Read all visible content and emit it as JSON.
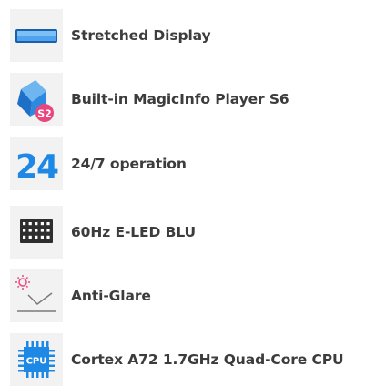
{
  "features": [
    {
      "icon": "stretched-display-icon",
      "label": "Stretched Display"
    },
    {
      "icon": "magicinfo-player-icon",
      "badge": "S2",
      "label": "Built-in MagicInfo Player S6"
    },
    {
      "icon": "operation-24-icon",
      "number": "24",
      "label": "24/7 operation"
    },
    {
      "icon": "eled-blu-icon",
      "label": "60Hz E-LED BLU"
    },
    {
      "icon": "anti-glare-icon",
      "label": "Anti-Glare"
    },
    {
      "icon": "cpu-icon",
      "chip_text": "CPU",
      "label": "Cortex A72 1.7GHz Quad-Core CPU"
    }
  ],
  "colors": {
    "accent_blue": "#1e88e5",
    "badge_pink": "#e8467c",
    "text": "#3c3c3c",
    "icon_bg": "#f2f2f2"
  }
}
